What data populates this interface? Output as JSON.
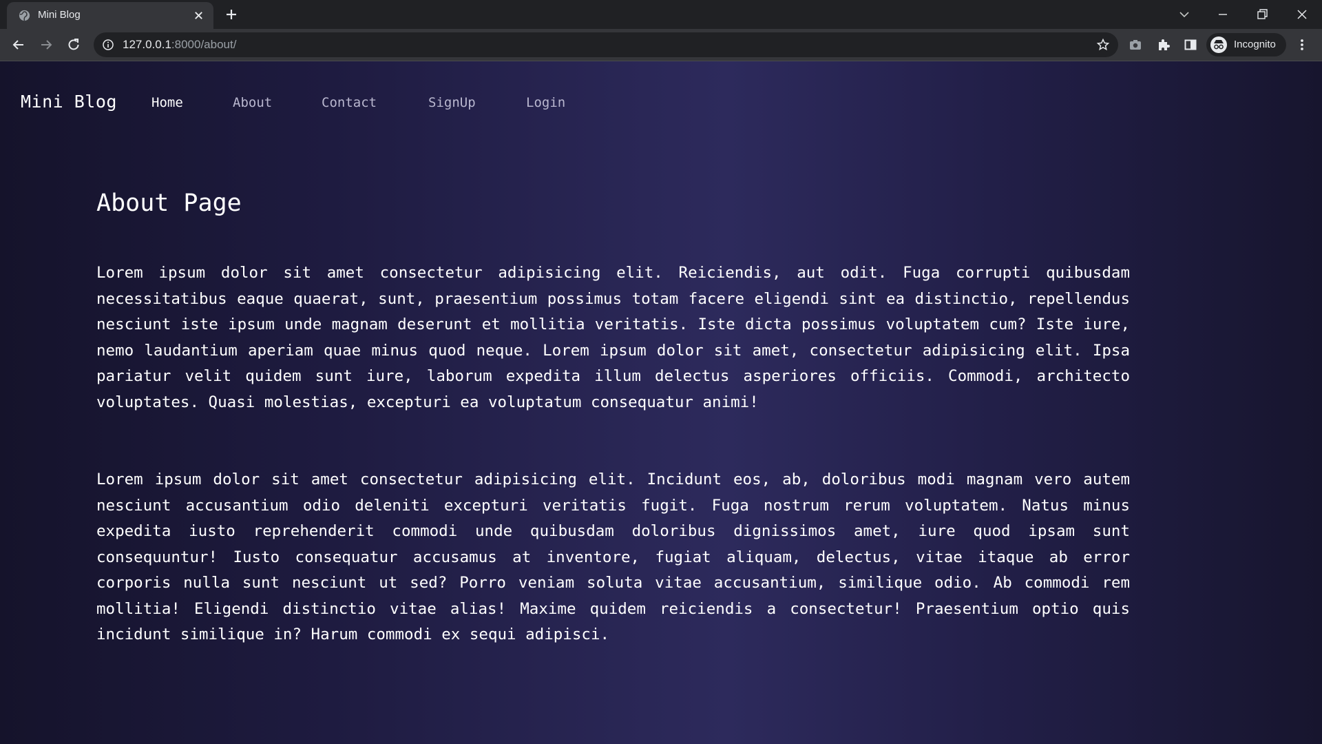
{
  "browser": {
    "tab_title": "Mini Blog",
    "url_host": "127.0.0.1",
    "url_path": ":8000/about/",
    "profile_label": "Incognito"
  },
  "site": {
    "brand": "Mini Blog",
    "nav": [
      {
        "label": "Home",
        "active": true
      },
      {
        "label": "About",
        "active": false
      },
      {
        "label": "Contact",
        "active": false
      },
      {
        "label": "SignUp",
        "active": false
      },
      {
        "label": "Login",
        "active": false
      }
    ]
  },
  "content": {
    "heading": "About Page",
    "paragraphs": [
      "Lorem ipsum dolor sit amet consectetur adipisicing elit. Reiciendis, aut odit. Fuga corrupti quibusdam necessitatibus eaque quaerat, sunt, praesentium possimus totam facere eligendi sint ea distinctio, repellendus nesciunt iste ipsum unde magnam deserunt et mollitia veritatis. Iste dicta possimus voluptatem cum? Iste iure, nemo laudantium aperiam quae minus quod neque. Lorem ipsum dolor sit amet, consectetur adipisicing elit. Ipsa pariatur velit quidem sunt iure, laborum expedita illum delectus asperiores officiis. Commodi, architecto voluptates. Quasi molestias, excepturi ea voluptatum consequatur animi!",
      "Lorem ipsum dolor sit amet consectetur adipisicing elit. Incidunt eos, ab, doloribus modi magnam vero autem nesciunt accusantium odio deleniti excepturi veritatis fugit. Fuga nostrum rerum voluptatem. Natus minus expedita iusto reprehenderit commodi unde quibusdam doloribus dignissimos amet, iure quod ipsam sunt consequuntur! Iusto consequatur accusamus at inventore, fugiat aliquam, delectus, vitae itaque ab error corporis nulla sunt nesciunt ut sed? Porro veniam soluta vitae accusantium, similique odio. Ab commodi rem mollitia! Eligendi distinctio vitae alias! Maxime quidem reiciendis a consectetur! Praesentium optio quis incidunt similique in? Harum commodi ex sequi adipisci."
    ]
  },
  "icons": {
    "tab_favicon": "globe-icon",
    "tab_close": "close-icon",
    "new_tab": "plus-icon",
    "back": "back-arrow-icon",
    "forward": "forward-arrow-icon",
    "reload": "reload-icon",
    "site_info": "info-icon",
    "bookmark": "star-icon",
    "camera": "camera-icon",
    "extensions": "puzzle-icon",
    "side_panel": "side-panel-icon",
    "incognito": "incognito-icon",
    "menu": "kebab-menu-icon"
  },
  "colors": {
    "chrome_dark": "#202124",
    "chrome_toolbar": "#35363a",
    "page_bg_mid": "#2d2a5c",
    "nav_inactive": "#b9b7cf",
    "text": "#ffffff"
  }
}
